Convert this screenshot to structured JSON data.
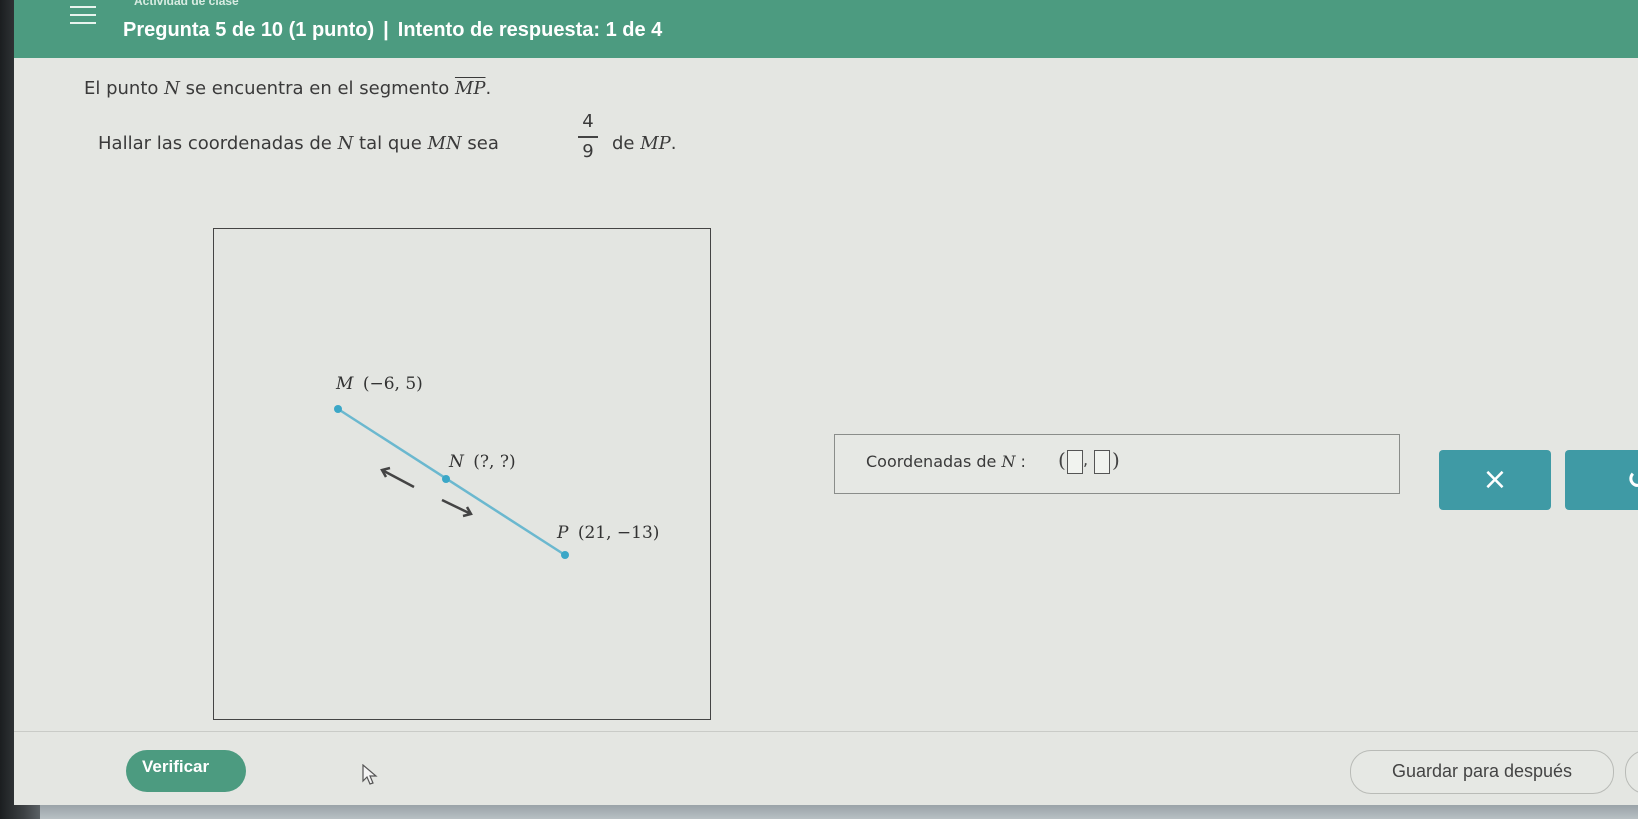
{
  "header": {
    "app_title": "Actividad de clase",
    "question_info": "Pregunta 5 de 10 (1 punto)",
    "separator": "|",
    "attempt_info": "Intento de respuesta: 1 de 4"
  },
  "question": {
    "line1_pre": "El punto ",
    "point_n": "N",
    "line1_mid": " se encuentra en el segmento ",
    "segment": "MP",
    "line1_end": ".",
    "line2_pre": "Hallar las coordenadas de ",
    "line2_mid": " tal que ",
    "mn": "MN",
    "sea": " sea ",
    "frac_num": "4",
    "frac_den": "9",
    "de": "de ",
    "mp": "MP",
    "period": "."
  },
  "graph": {
    "m_label": "M",
    "m_coords": "(−6, 5)",
    "n_label": "N",
    "n_coords": "(?, ?)",
    "p_label": "P",
    "p_coords": "(21, −13)",
    "line_color": "#6bb8cf",
    "point_color": "#3ba7c7"
  },
  "answer": {
    "label": "Coordenadas de ",
    "var": "N",
    "colon": " : ",
    "open_paren": "(",
    "comma": ",",
    "close_paren": ")",
    "x_value": "",
    "y_value": ""
  },
  "buttons": {
    "clear": "×",
    "undo": "↺",
    "verify": "Verificar",
    "save": "Guardar para después"
  },
  "colors": {
    "header_bg": "#4c9b80",
    "action_button": "#3f9aa5"
  }
}
